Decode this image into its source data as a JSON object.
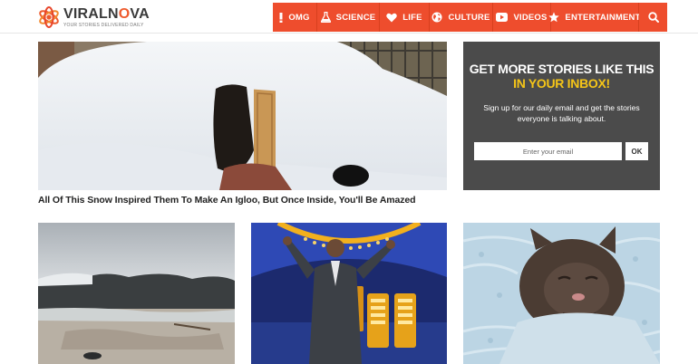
{
  "site": {
    "name_part1": "VIRALN",
    "name_o": "O",
    "name_part2": "VA",
    "tagline": "YOUR STORIES DELIVERED DAILY"
  },
  "nav": {
    "items": [
      {
        "label": "OMG",
        "icon": "exclamation-icon"
      },
      {
        "label": "SCIENCE",
        "icon": "flask-icon"
      },
      {
        "label": "LIFE",
        "icon": "heart-icon"
      },
      {
        "label": "CULTURE",
        "icon": "globe-icon"
      },
      {
        "label": "VIDEOS",
        "icon": "play-icon"
      },
      {
        "label": "ENTERTAINMENT",
        "icon": "star-icon"
      }
    ],
    "search_icon": "search-icon"
  },
  "featured": {
    "title": "All Of This Snow Inspired Them To Make An Igloo, But Once Inside, You'll Be Amazed"
  },
  "signup": {
    "heading_line1": "GET MORE STORIES LIKE THIS",
    "heading_line2": "IN YOUR INBOX!",
    "description": "Sign up for our daily email and get the stories everyone is talking about.",
    "email_placeholder": "Enter your email",
    "submit_label": "OK"
  },
  "colors": {
    "brand": "#ee4d2d",
    "highlight": "#f5c518",
    "signup_bg": "#4b4b4b"
  }
}
